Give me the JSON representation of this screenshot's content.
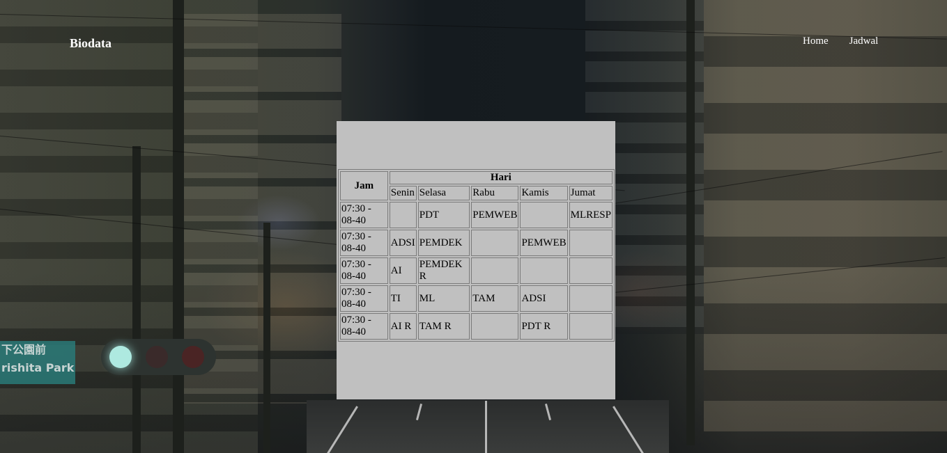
{
  "navbar": {
    "brand": "Biodata",
    "links": [
      {
        "label": "Home"
      },
      {
        "label": "Jadwal"
      }
    ]
  },
  "background": {
    "sign_text": [
      "下公園前",
      "rishita Park"
    ]
  },
  "schedule": {
    "header_time": "Jam",
    "header_days_group": "Hari",
    "days": [
      "Senin",
      "Selasa",
      "Rabu",
      "Kamis",
      "Jumat"
    ],
    "rows": [
      {
        "time": "07:30 - 08-40",
        "cells": [
          "",
          "PDT",
          "PEMWEB",
          "",
          "MLRESP"
        ]
      },
      {
        "time": "07:30 - 08-40",
        "cells": [
          "ADSI",
          "PEMDEK",
          "",
          "PEMWEB",
          ""
        ]
      },
      {
        "time": "07:30 - 08-40",
        "cells": [
          "AI",
          "PEMDEK R",
          "",
          "",
          ""
        ]
      },
      {
        "time": "07:30 - 08-40",
        "cells": [
          "TI",
          "ML",
          "TAM",
          "ADSI",
          ""
        ]
      },
      {
        "time": "07:30 - 08-40",
        "cells": [
          "AI R",
          "TAM R",
          "",
          "PDT R",
          ""
        ]
      }
    ]
  },
  "colors": {
    "panel_bg": "#c0c0c0",
    "nav_text": "#ffffff"
  }
}
